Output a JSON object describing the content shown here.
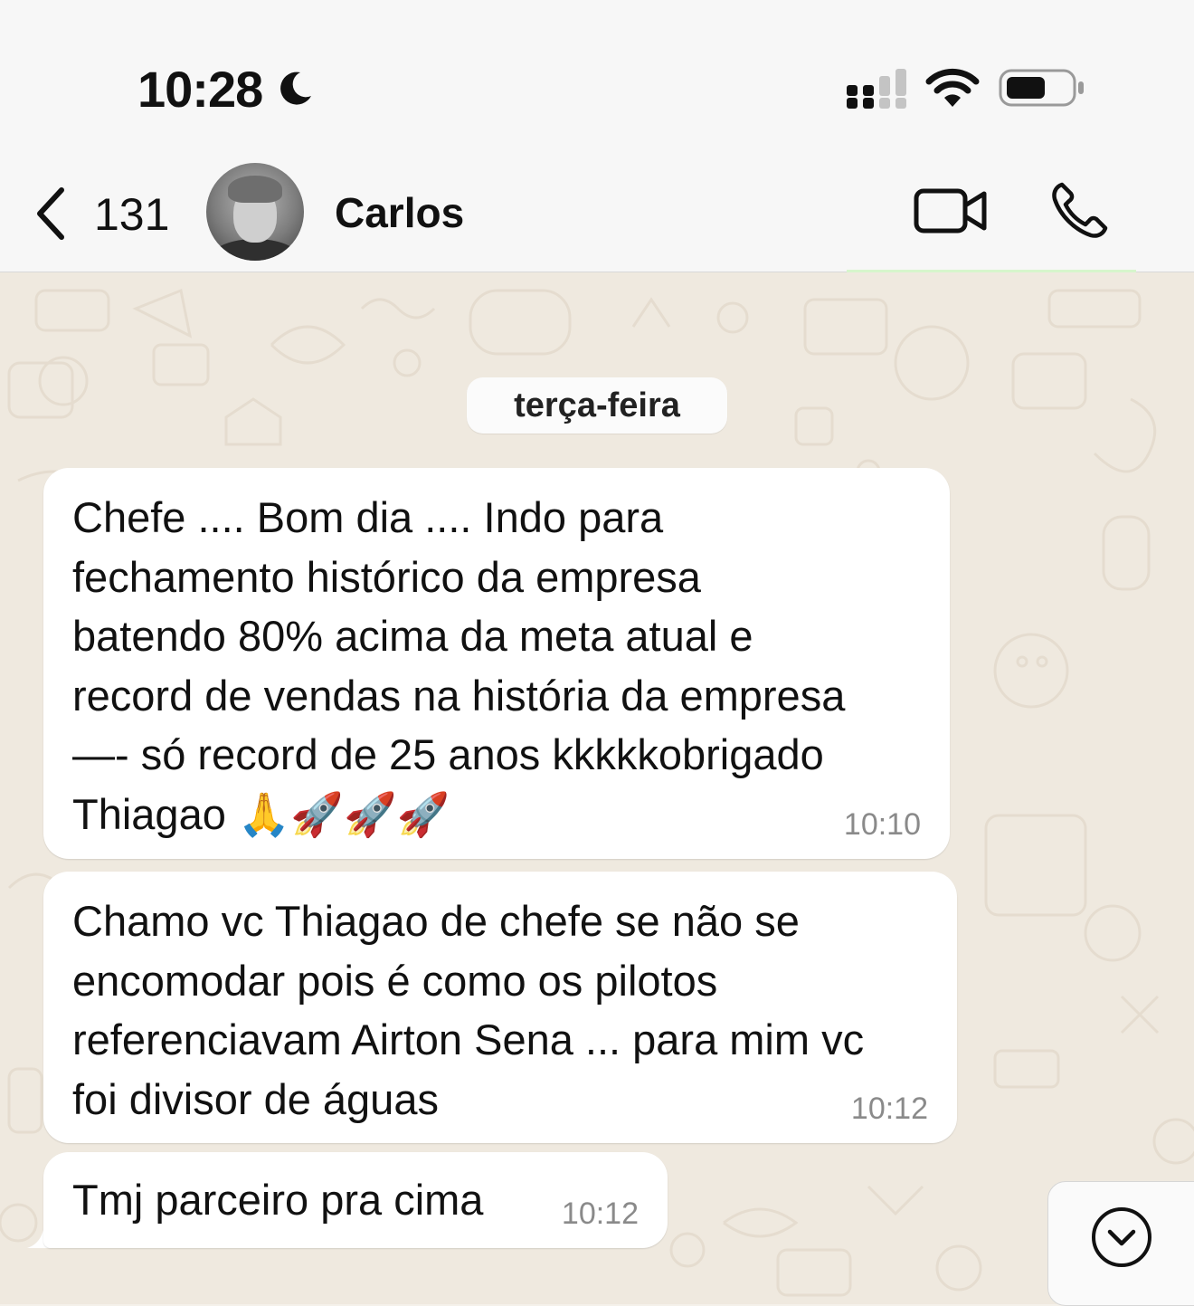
{
  "status_bar": {
    "time": "10:28",
    "icons": [
      "moon-icon",
      "cellular-signal-icon",
      "wifi-icon",
      "battery-icon"
    ]
  },
  "header": {
    "back_count": "131",
    "contact_name": "Carlos",
    "icons": [
      "chevron-left-icon",
      "video-call-icon",
      "phone-icon"
    ]
  },
  "chat": {
    "date_divider": "terça-feira",
    "messages": [
      {
        "text": "Chefe .... Bom dia .... Indo para\nfechamento histórico da empresa\nbatendo 80% acima da meta atual e\nrecord de vendas na história da empresa\n—- só record de 25 anos kkkkkobrigado\nThiagao 🙏🚀🚀🚀",
        "time": "10:10"
      },
      {
        "text": "Chamo vc Thiagao de chefe se não se\nencomodar pois é como os pilotos\nreferenciavam Airton Sena ... para mim vc\nfoi divisor de águas",
        "time": "10:12"
      },
      {
        "text": "Tmj parceiro pra cima",
        "time": "10:12"
      }
    ],
    "scroll_button_icon": "chevron-down-circle-icon"
  },
  "colors": {
    "bubble_incoming": "#ffffff",
    "chat_background": "#efe9df",
    "header_background": "#f7f7f7",
    "timestamp": "#8a8a8a"
  }
}
